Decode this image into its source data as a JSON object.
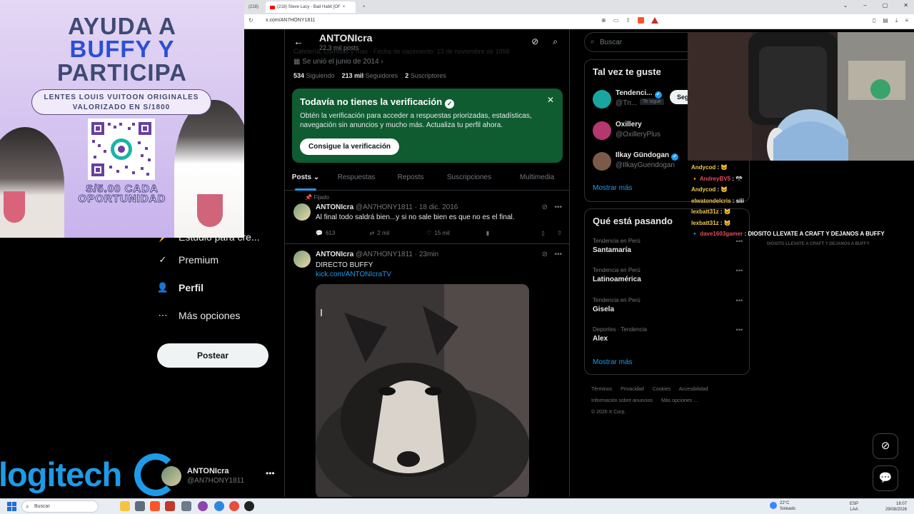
{
  "browser": {
    "tab_first": "(218)",
    "tab_active": "(218) Steve Lacy - Bad Habit [OF",
    "url": "x.com/AN7HONY1811"
  },
  "nav": {
    "partial_label": "Estudio para cre...",
    "premium": "Premium",
    "profile": "Perfil",
    "more": "Más opciones",
    "post_button": "Postear",
    "account_name": "ANTONIcra",
    "account_handle": "@AN7HONY1811"
  },
  "profile": {
    "name": "ANTONIcra",
    "post_count": "22,3 mil posts",
    "bio_cut": "Cafetería, Comidas y mas   ·   Fecha de nacimiento: 13 de noviembre de 1998",
    "joined": "Se unió el junio de 2014",
    "following_count": "534",
    "following_label": "Siguiendo",
    "followers_count": "213 mil",
    "followers_label": "Seguidores",
    "subs_count": "2",
    "subs_label": "Suscriptores"
  },
  "verification": {
    "title": "Todavía no tienes la verificación",
    "body": "Obtén la verificación para acceder a respuestas priorizadas, estadísticas, navegación sin anuncios y mucho más. Actualiza tu perfil ahora.",
    "button": "Consigue la verificación"
  },
  "tabs": [
    "Posts",
    "Respuestas",
    "Reposts",
    "Suscripciones",
    "Multimedia"
  ],
  "posts": [
    {
      "pinned_label": "Fijado",
      "name": "ANTONIcra",
      "meta": "@AN7HONY1811 · 18 dic. 2016",
      "text": "Al final todo saldrá bien...y si no sale bien es que no es el final.",
      "replies": "613",
      "reposts": "2 mil",
      "likes": "15 mil"
    },
    {
      "name": "ANTONIcra",
      "meta": "@AN7HONY1811 · 23min",
      "text": "DIRECTO BUFFY",
      "link": "kick.com/ANTONIcraTV"
    }
  ],
  "right": {
    "search_placeholder": "Buscar",
    "wtf_title": "Tal vez te guste",
    "who": [
      {
        "name": "Tendenci...",
        "handle": "@Tn...",
        "tag": "Te sigue",
        "button": "Seg",
        "color": "#1aa6a0"
      },
      {
        "name": "Oxillery",
        "handle": "@OxilleryPlus",
        "color": "#b33870"
      },
      {
        "name": "Ilkay Gündogan",
        "handle": "@IlkayGuendogan",
        "color": "#7b5a4a"
      }
    ],
    "show_more": "Mostrar más",
    "trends_title": "Qué está pasando",
    "trends": [
      {
        "context": "Tendencia en Perú",
        "name": "Santamaría"
      },
      {
        "context": "Tendencia en Perú",
        "name": "Latinoamérica"
      },
      {
        "context": "Tendencia en Perú",
        "name": "Gisela"
      },
      {
        "context": "Deportes · Tendencia",
        "name": "Alex"
      }
    ],
    "footer": [
      "Términos",
      "Privacidad",
      "Cookies",
      "Accesibilidad",
      "Información sobre anuncios",
      "Más opciones ...",
      "© 2026 X Corp."
    ]
  },
  "promo": {
    "line1": "AYUDA A",
    "line2": "BUFFY Y",
    "line3": "PARTICIPA",
    "pill_line1": "LENTES LOUIS VUITOON ORIGINALES",
    "pill_line2": "VALORIZADO EN S/1800",
    "price_line1": "S/5.00 CADA",
    "price_line2": "OPORTUNIDAD"
  },
  "chat": [
    {
      "user": "Andycod",
      "msg": "",
      "style": "normal"
    },
    {
      "user": "AndreyBV5",
      "msg": "",
      "style": "red"
    },
    {
      "user": "Andycod",
      "msg": "",
      "style": "normal"
    },
    {
      "user": "elwatondelcris",
      "msg": "siii",
      "style": "normal"
    },
    {
      "user": "lexbatt31z",
      "msg": "",
      "style": "normal"
    },
    {
      "user": "lexbatt31z",
      "msg": "",
      "style": "normal"
    },
    {
      "user": "dave1603gamer",
      "msg": "DIOSITO LLEVATE A CRAFT Y DEJANOS A BUFFY",
      "style": "red"
    },
    {
      "user": "",
      "msg": "DIOSITO LLEVATE A CRAFT Y DEJANOS A BUFFY",
      "style": "dim"
    }
  ],
  "overlay_brand": "logitech",
  "taskbar": {
    "search": "Buscar",
    "temperature": "22°C",
    "weather": "Soleado",
    "lang1": "ESP",
    "lang2": "LAA",
    "time": "18:07",
    "date": "29/08/2026"
  }
}
